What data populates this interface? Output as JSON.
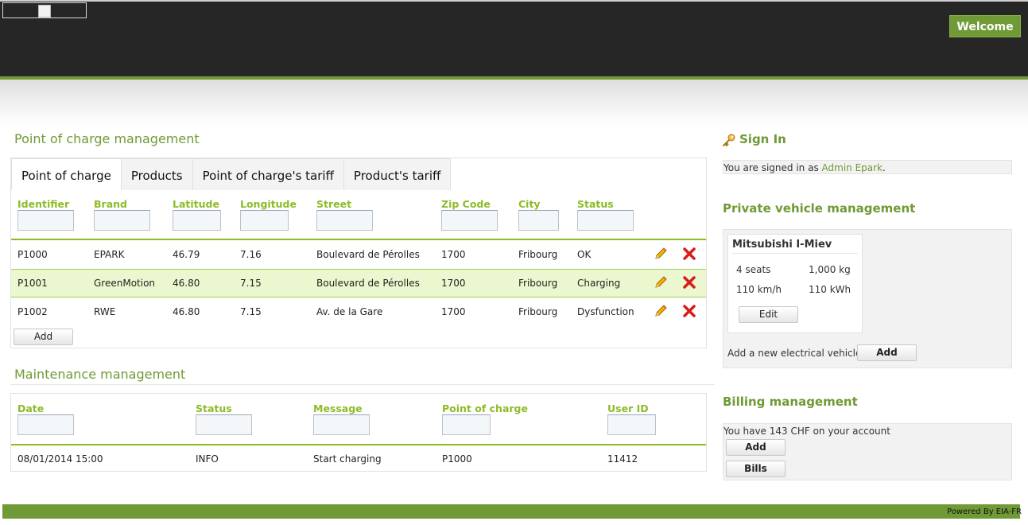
{
  "header": {
    "welcome_label": "Welcome"
  },
  "poc": {
    "title": "Point of charge management",
    "tabs": [
      "Point of charge",
      "Products",
      "Point of charge's tariff",
      "Product's tariff"
    ],
    "columns": [
      "Identifier",
      "Brand",
      "Latitude",
      "Longitude",
      "Street",
      "Zip Code",
      "City",
      "Status"
    ],
    "rows": [
      [
        "P1000",
        "EPARK",
        "46.79",
        "7.16",
        "Boulevard de Pérolles",
        "1700",
        "Fribourg",
        "OK"
      ],
      [
        "P1001",
        "GreenMotion",
        "46.80",
        "7.15",
        "Boulevard de Pérolles",
        "1700",
        "Fribourg",
        "Charging"
      ],
      [
        "P1002",
        "RWE",
        "46.80",
        "7.15",
        "Av. de la Gare",
        "1700",
        "Fribourg",
        "Dysfunction"
      ]
    ],
    "add_label": "Add",
    "colors": {
      "accent": "#6f9a35",
      "header_text": "#8dbb26",
      "highlight_row": "#ebf8cf"
    }
  },
  "maintenance": {
    "title": "Maintenance management",
    "columns": [
      "Date",
      "Status",
      "Message",
      "Point of charge",
      "User ID"
    ],
    "rows": [
      [
        "08/01/2014 15:00",
        "INFO",
        "Start charging",
        "P1000",
        "11412"
      ]
    ]
  },
  "signin": {
    "title": "Sign In",
    "text_prefix": "You are signed in as ",
    "user": "Admin Epark",
    "text_suffix": "."
  },
  "vehicle": {
    "title": "Private vehicle management",
    "card_name": "Mitsubishi I-Miev",
    "seats": "4 seats",
    "weight": "1,000 kg",
    "speed": "110 km/h",
    "battery": "110 kWh",
    "edit_label": "Edit",
    "add_text": "Add a new electrical vehicle",
    "add_label": "Add"
  },
  "billing": {
    "title": "Billing management",
    "text": "You have 143 CHF on your account",
    "add_label": "Add",
    "bills_label": "Bills"
  },
  "footer": {
    "text": "Powered By EIA-FR"
  },
  "icons": {
    "edit": "pencil-icon",
    "delete": "delete-x-icon",
    "signin": "key-icon"
  }
}
